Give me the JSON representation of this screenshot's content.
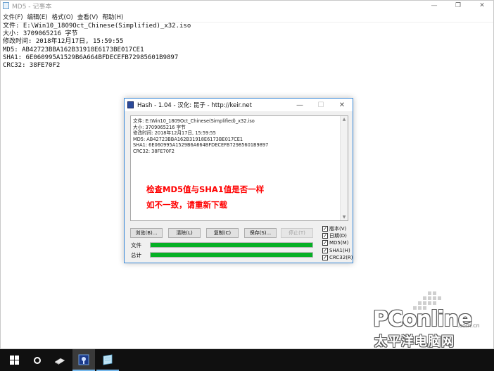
{
  "notepad": {
    "title": "MD5 - 记事本",
    "caption": {
      "minimize": "—",
      "maximize": "❐",
      "close": "✕"
    },
    "menu": [
      "文件(F)",
      "编辑(E)",
      "格式(O)",
      "查看(V)",
      "帮助(H)"
    ],
    "lines": [
      "文件: E:\\Win10_1809Oct_Chinese(Simplified)_x32.iso",
      "大小: 3709065216 字节",
      "修改时间: 2018年12月17日, 15:59:55",
      "MD5: AB42723BBA162B31918E6173BE017CE1",
      "SHA1: 6E060995A1529B6A664BFDECEFB72985601B9897",
      "CRC32: 38FE70F2"
    ]
  },
  "dialog": {
    "title": "Hash - 1.04 - 汉化: 昆子 - http://keir.net",
    "caption": {
      "minimize": "—",
      "maximize": "☐",
      "close": "✕"
    },
    "output_lines": [
      "文件: E:\\Win10_1809Oct_Chinese(Simplified)_x32.iso",
      "大小: 3709065216 字节",
      "修改时间: 2018年12月17日, 15:59:55",
      "MD5: AB42723BBA162B31918E6173BE017CE1",
      "SHA1: 6E060995A1529B6A664BFDECEFB72985601B9897",
      "CRC32: 38FE70F2"
    ],
    "annotation_line1": "检查MD5值与SHA1值是否一样",
    "annotation_line2": "如不一致，请重新下载",
    "buttons": {
      "browse": "浏览(B)...",
      "clear": "清除(L)",
      "copy": "复制(C)",
      "save": "保存(S)...",
      "stop": "停止(T)"
    },
    "progress": {
      "file_label": "文件",
      "file_value": 1.0,
      "total_label": "总计",
      "total_value": 1.0
    },
    "options": [
      {
        "label": "版本(V)",
        "checked": true
      },
      {
        "label": "日期(D)",
        "checked": true
      },
      {
        "label": "MD5(M)",
        "checked": true
      },
      {
        "label": "SHA1(H)",
        "checked": true
      },
      {
        "label": "CRC32(R)",
        "checked": true
      }
    ],
    "colors": {
      "progress": "#06b025",
      "annotation": "#ff0000"
    }
  },
  "watermark": {
    "brand": "PConline",
    "domain": ".com.cn",
    "chinese": "太平洋电脑网"
  },
  "taskbar": {
    "icons": [
      "windows-start-icon",
      "cortana-search-icon",
      "device-app-icon",
      "hash-app-icon",
      "notepad-app-icon"
    ]
  }
}
